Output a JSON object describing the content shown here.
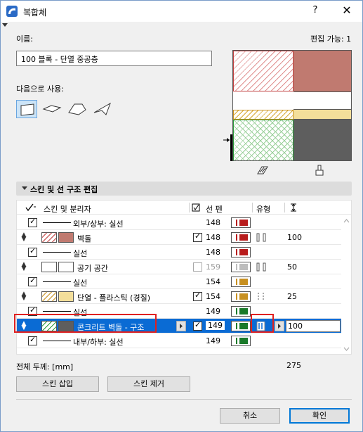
{
  "window": {
    "title": "복합체",
    "help": "?",
    "close": "✕"
  },
  "name_label": "이름:",
  "edit_label": "편집 가능: 1",
  "name_value": "100 블록 - 단열 중공층",
  "use_label": "다음으로 사용:",
  "use_icons": [
    "wall-icon",
    "slab-icon",
    "roof-icon",
    "shell-icon"
  ],
  "section_title": "스킨 및 선 구조 편집",
  "headers": {
    "skins": "스킨 및 분리자",
    "pen": "선 펜",
    "type": "유형",
    "thickness_icon": "thickness-icon"
  },
  "rows": [
    {
      "kind": "line",
      "label": "외부/상부: 실선",
      "pen": "148",
      "checked": true,
      "pen_color": "#b81c1c"
    },
    {
      "kind": "skin",
      "label": "벽돌",
      "pen": "148",
      "checked": true,
      "type": "solid",
      "thickness": "100",
      "fill": "#c07a70",
      "hatch": "#c04040",
      "pen_color": "#b81c1c"
    },
    {
      "kind": "line",
      "label": "실선",
      "pen": "148",
      "checked": true,
      "pen_color": "#b81c1c"
    },
    {
      "kind": "skin",
      "label": "공기 공간",
      "pen": "159",
      "checked": false,
      "type": "solid",
      "thickness": "50",
      "fill": "#ffffff",
      "hatch": "#ffffff",
      "pen_color": "#bdbdbd"
    },
    {
      "kind": "line",
      "label": "실선",
      "pen": "154",
      "checked": true,
      "pen_color": "#c89020"
    },
    {
      "kind": "skin",
      "label": "단열 - 플라스틱 (경질)",
      "pen": "154",
      "checked": true,
      "type": "dashed",
      "thickness": "25",
      "fill": "#f3de9a",
      "hatch": "#c89020",
      "pen_color": "#c89020"
    },
    {
      "kind": "line",
      "label": "실선",
      "pen": "149",
      "checked": true,
      "pen_color": "#1a7a2a"
    },
    {
      "kind": "skin",
      "label": "콘크리트 벽돌 - 구조",
      "pen": "149",
      "checked": true,
      "type": "structural",
      "thickness": "100",
      "fill": "#5e5e5e",
      "hatch": "#2a9a3a",
      "pen_color": "#1a7a2a",
      "selected": true
    },
    {
      "kind": "line",
      "label": "내부/하부: 실선",
      "pen": "149",
      "checked": true,
      "pen_color": "#1a7a2a"
    }
  ],
  "total_label": "전체 두께: [mm]",
  "total_value": "275",
  "insert_skin": "스킨 삽입",
  "remove_skin": "스킨 제거",
  "cancel": "취소",
  "ok": "확인",
  "colors": {
    "selection": "#0a6bd4",
    "brick": "#c07a70",
    "insulation": "#f3de9a",
    "concrete": "#5e5e5e",
    "highlight": "#e02020"
  }
}
